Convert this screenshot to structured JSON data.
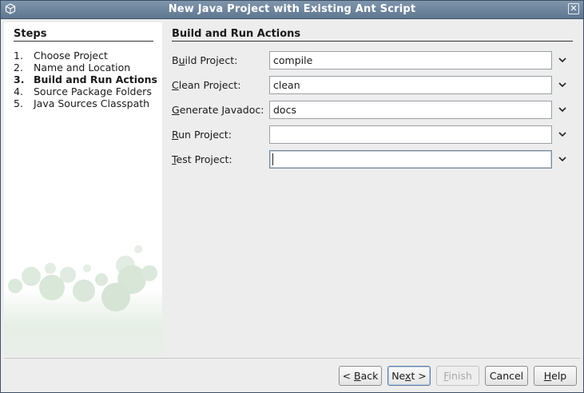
{
  "window": {
    "title": "New Java Project with Existing Ant Script"
  },
  "steps": {
    "heading": "Steps",
    "items": [
      {
        "num": "1.",
        "label": "Choose Project",
        "current": false
      },
      {
        "num": "2.",
        "label": "Name and Location",
        "current": false
      },
      {
        "num": "3.",
        "label": "Build and Run Actions",
        "current": true
      },
      {
        "num": "4.",
        "label": "Source Package Folders",
        "current": false
      },
      {
        "num": "5.",
        "label": "Java Sources Classpath",
        "current": false
      }
    ]
  },
  "main": {
    "heading": "Build and Run Actions",
    "fields": [
      {
        "label": "Build Project:",
        "mnemonic": "u",
        "value": "compile"
      },
      {
        "label": "Clean Project:",
        "mnemonic": "C",
        "value": "clean"
      },
      {
        "label": "Generate Javadoc:",
        "mnemonic": "G",
        "value": "docs"
      },
      {
        "label": "Run Project:",
        "mnemonic": "R",
        "value": ""
      },
      {
        "label": "Test Project:",
        "mnemonic": "T",
        "value": ""
      }
    ]
  },
  "buttons": {
    "back": "< Back",
    "next": "Next >",
    "finish": "Finish",
    "cancel": "Cancel",
    "help": "Help"
  },
  "colors": {
    "titlebar": "#6f86a0",
    "panel_background": "#ededed",
    "steps_background": "#ffffff"
  }
}
